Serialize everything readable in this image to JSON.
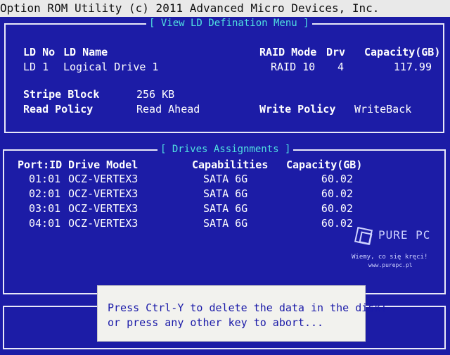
{
  "window": {
    "title": "Option ROM Utility (c) 2011 Advanced Micro Devices, Inc."
  },
  "ld_panel": {
    "title": "[ View LD Defination Menu ]",
    "headers": {
      "ld_no": "LD No",
      "ld_name": "LD Name",
      "raid_mode": "RAID Mode",
      "drv": "Drv",
      "capacity": "Capacity(GB)"
    },
    "row": {
      "ld_no": "LD  1",
      "ld_name": "Logical Drive 1",
      "raid_mode": "RAID 10",
      "drv": "4",
      "capacity": "117.99"
    },
    "stripe_block_label": "Stripe Block",
    "stripe_block_value": "256 KB",
    "read_policy_label": "Read Policy",
    "read_policy_value": "Read Ahead",
    "write_policy_label": "Write Policy",
    "write_policy_value": "WriteBack"
  },
  "drives_panel": {
    "title": "[ Drives Assignments ]",
    "headers": {
      "port_id": "Port:ID",
      "drive_model": "Drive Model",
      "capabilities": "Capabilities",
      "capacity": "Capacity(GB)"
    },
    "rows": [
      {
        "port_id": "01:01",
        "drive_model": "OCZ-VERTEX3",
        "capabilities": "SATA 6G",
        "capacity": "60.02"
      },
      {
        "port_id": "02:01",
        "drive_model": "OCZ-VERTEX3",
        "capabilities": "SATA 6G",
        "capacity": "60.02"
      },
      {
        "port_id": "03:01",
        "drive_model": "OCZ-VERTEX3",
        "capabilities": "SATA 6G",
        "capacity": "60.02"
      },
      {
        "port_id": "04:01",
        "drive_model": "OCZ-VERTEX3",
        "capabilities": "SATA 6G",
        "capacity": "60.02"
      }
    ]
  },
  "dialog": {
    "line1": "Press Ctrl-Y to delete the data in the disk!",
    "line2": "or press any other key to abort..."
  },
  "watermark": {
    "brand": "PURE PC",
    "tagline": "Wiemy, co się kręci!",
    "url": "www.purepc.pl"
  },
  "colors": {
    "background": "#1c1ca6",
    "title_bar": "#e9e9e9",
    "panel_title": "#50e0e0",
    "dialog_bg": "#f2f2ee",
    "dialog_text": "#1a1aa8"
  }
}
